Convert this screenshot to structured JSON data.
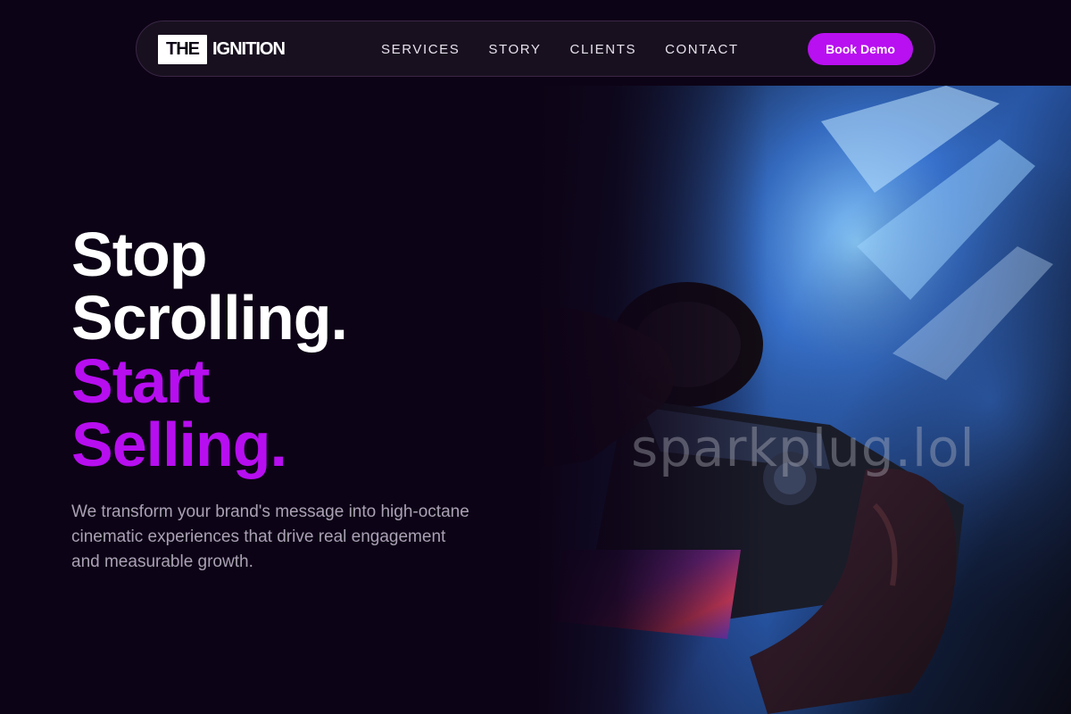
{
  "nav": {
    "logo_box": "THE",
    "logo_text": "IGNITION",
    "links": [
      "SERVICES",
      "STORY",
      "CLIENTS",
      "CONTACT"
    ],
    "cta_label": "Book Demo"
  },
  "hero": {
    "headline_line1": "Stop",
    "headline_line2": "Scrolling.",
    "headline_line3": "Start",
    "headline_line4": "Selling.",
    "subtitle": "We transform your brand's message into high-octane cinematic experiences that drive real engagement and measurable growth.",
    "image_watermark": "sparkplug.lol"
  },
  "colors": {
    "background": "#0d0316",
    "accent": "#b810f0",
    "headline_accent": "#b70ef0",
    "nav_bg": "#18101f",
    "subtitle": "#aaa1b4"
  }
}
